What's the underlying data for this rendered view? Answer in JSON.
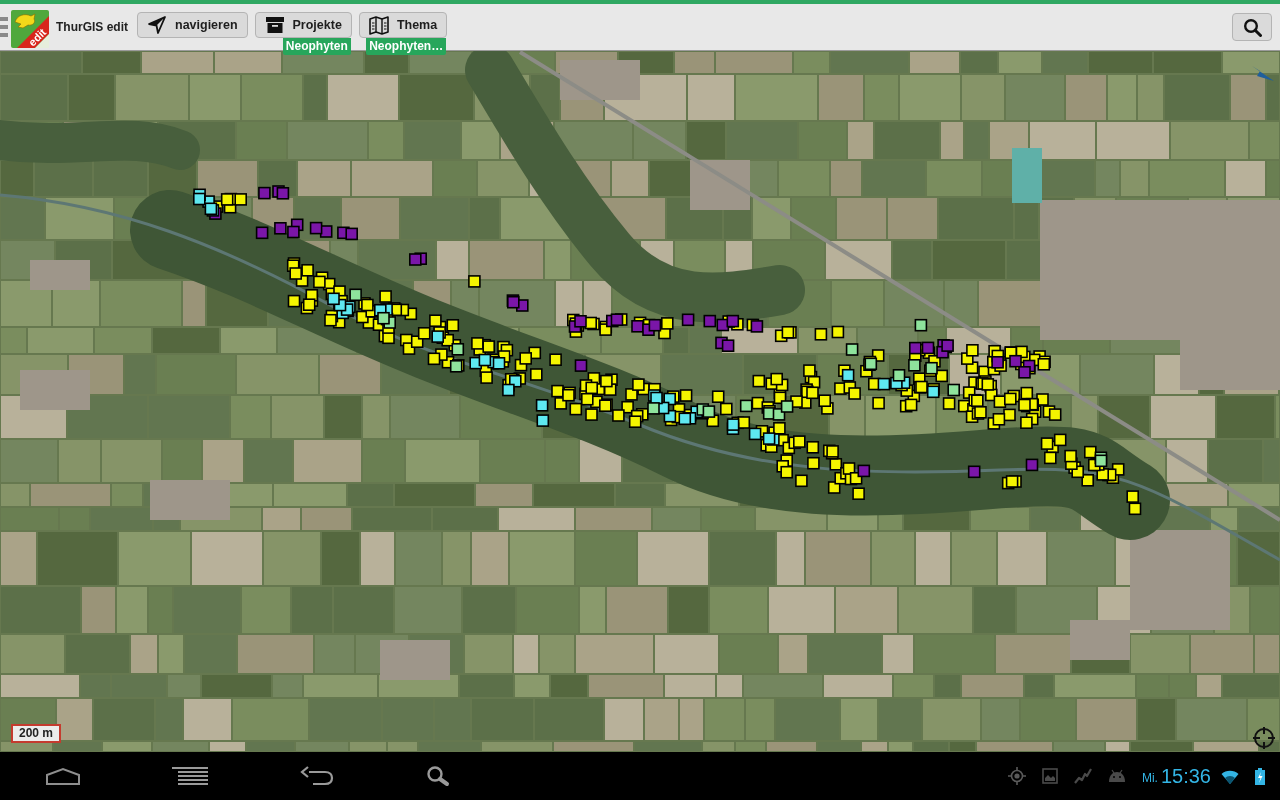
{
  "top_bar": {
    "logo_text": "edit",
    "title": "ThurGIS edit",
    "buttons": [
      {
        "kind": "navigate",
        "label": "navigieren"
      },
      {
        "kind": "projects",
        "label": "Projekte",
        "badge": "Neophyten"
      },
      {
        "kind": "theme",
        "label": "Thema",
        "badge": "Neophyten…"
      }
    ]
  },
  "map": {
    "marker_series": [
      {
        "color": "#f5f500"
      },
      {
        "color": "#7a16a8"
      },
      {
        "color": "#5ee8f0"
      },
      {
        "color": "#8ee39c"
      }
    ],
    "scale": "200 m"
  },
  "system_bar": {
    "day": "Mi.",
    "time": "15:36"
  }
}
